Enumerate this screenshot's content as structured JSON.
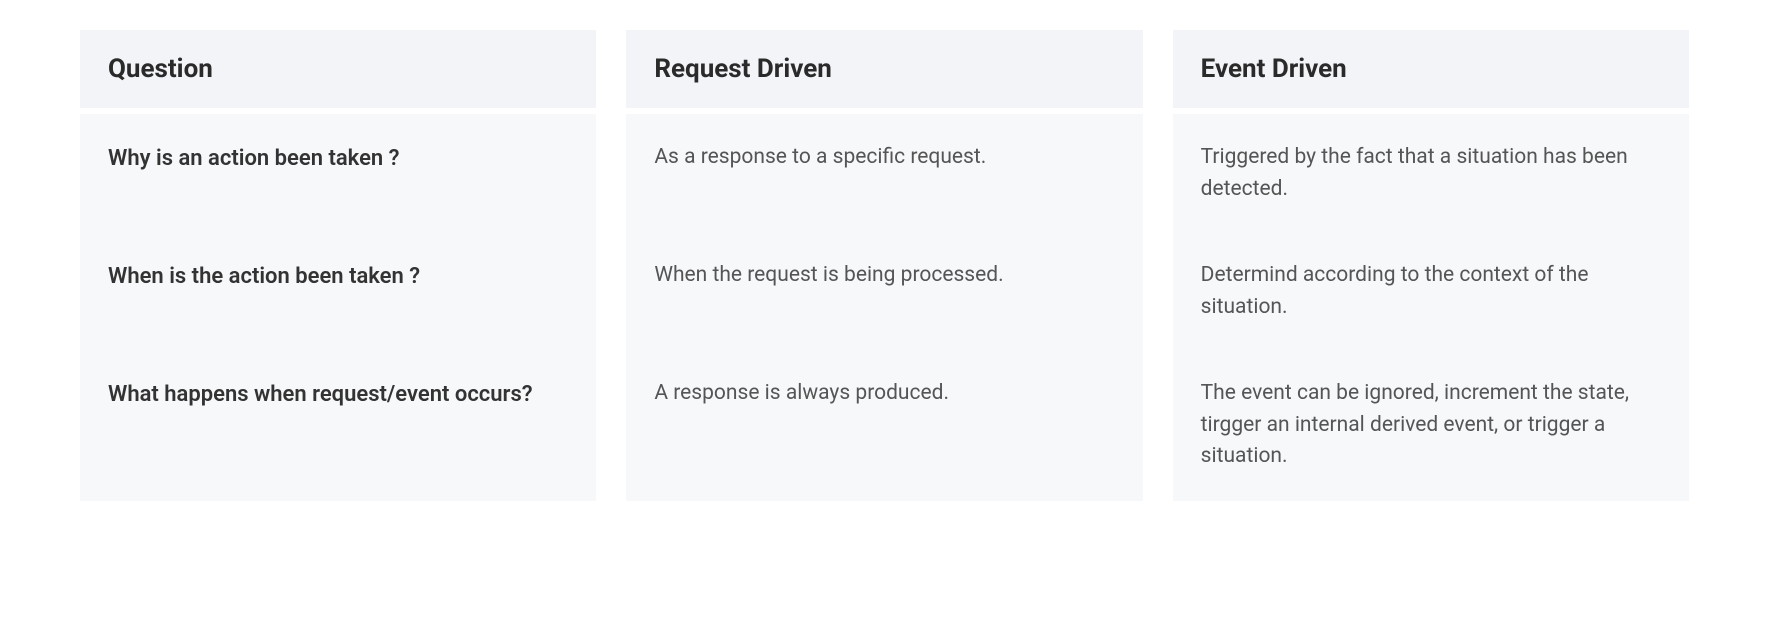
{
  "columns": {
    "question": {
      "header": "Question",
      "rows": [
        "Why is an action been taken ?",
        "When is the action been taken ?",
        "What happens when request/event occurs?"
      ]
    },
    "request_driven": {
      "header": "Request Driven",
      "rows": [
        "As a response to a specific request.",
        "When the request is being processed.",
        "A response is always produced."
      ]
    },
    "event_driven": {
      "header": "Event Driven",
      "rows": [
        "Triggered by the fact that a situation has been detected.",
        "Determind according to the context of the situation.",
        "The event can be ignored, increment the state, tirgger an internal derived event, or trigger a situation."
      ]
    }
  }
}
